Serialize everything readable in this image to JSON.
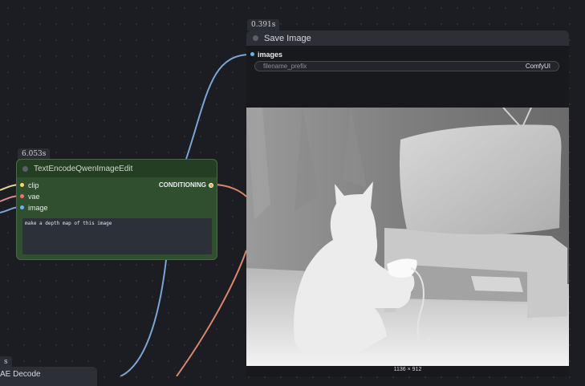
{
  "save_node": {
    "timing": "0.391s",
    "title": "Save Image",
    "input_label": "images",
    "widget_label": "filename_prefix",
    "widget_value": "ComfyUI",
    "image_size": "1136 × 912"
  },
  "text_node": {
    "timing": "6.053s",
    "title": "TextEncodeQwenImageEdit",
    "inputs": [
      "clip",
      "vae",
      "image"
    ],
    "output_label": "CONDITIONING",
    "prompt": "make a depth map of this image"
  },
  "vae_node": {
    "timing": "s",
    "title": "AE Decode"
  },
  "colors": {
    "clip": "#ffd966",
    "vae": "#ff6e6e",
    "image": "#64b5f6",
    "conditioning": "#ffa931",
    "wire_blue": "#7aa6d6",
    "wire_orange": "#d9866a"
  }
}
